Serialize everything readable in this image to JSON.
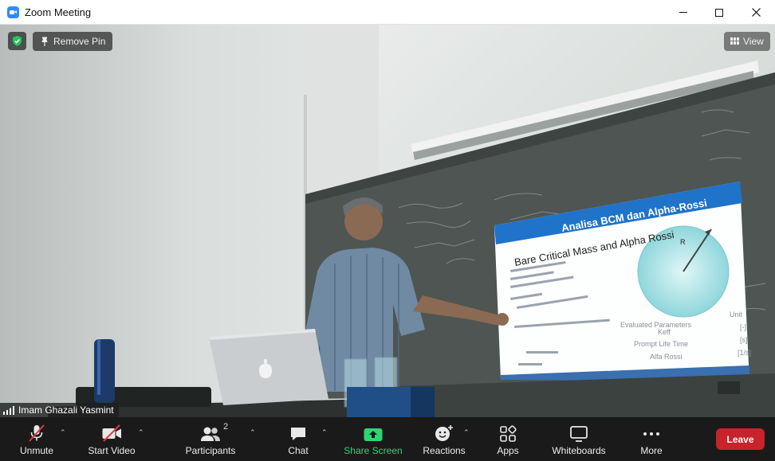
{
  "window": {
    "title": "Zoom Meeting",
    "controls": [
      "minimize",
      "maximize",
      "close"
    ]
  },
  "video": {
    "remove_pin_label": "Remove Pin",
    "view_label": "View",
    "participant_name": "Imam Ghazali Yasmint",
    "slide": {
      "banner": "Analisa BCM dan Alpha-Rossi",
      "title": "Bare Critical Mass and Alpha Rossi",
      "params_header": "Evaluated Parameters",
      "unit_header": "Unit",
      "rows": [
        {
          "name": "Keff",
          "unit": "[-]"
        },
        {
          "name": "Prompt Life Time",
          "unit": "[s]"
        },
        {
          "name": "Alfa Rossi",
          "unit": "[1/s]"
        }
      ],
      "radius_label": "R"
    }
  },
  "toolbar": {
    "unmute": "Unmute",
    "start_video": "Start Video",
    "participants": "Participants",
    "participants_count": "2",
    "chat": "Chat",
    "share_screen": "Share Screen",
    "reactions": "Reactions",
    "apps": "Apps",
    "whiteboards": "Whiteboards",
    "more": "More",
    "leave": "Leave"
  },
  "colors": {
    "share_green": "#2ed573",
    "leave_red": "#c8222a",
    "shield_green": "#22c55e",
    "zoom_blue": "#2d8cff",
    "slide_banner_blue": "#1f73c9"
  }
}
